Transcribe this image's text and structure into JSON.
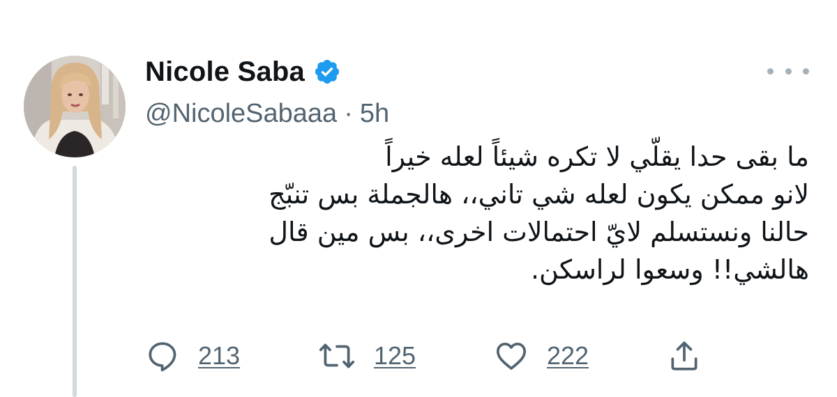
{
  "author": {
    "display_name": "Nicole Saba",
    "handle": "@NicoleSabaaa",
    "separator": "·",
    "time": "5h",
    "verified_icon": "verified-badge-icon",
    "avatar": "avatar"
  },
  "tweet": {
    "lines": [
      "ما بقى حدا يقلّي لا تكره شيئاً لعله خيراً",
      "لانو ممكن يكون لعله شي تاني،، هالجملة بس تنبّج",
      "حالنا ونستسلم لايّ احتمالات اخرى،، بس مين قال",
      "هالشي!! وسعوا لراسكن."
    ]
  },
  "actions": {
    "reply": {
      "icon": "reply-icon",
      "count": "213"
    },
    "retweet": {
      "icon": "retweet-icon",
      "count": "125"
    },
    "like": {
      "icon": "heart-icon",
      "count": "222"
    },
    "share": {
      "icon": "share-icon"
    }
  },
  "more_icon": "more-options-icon",
  "colors": {
    "verified": "#1d9bf0",
    "text": "#0f1419",
    "secondary": "#536471",
    "thread_line": "#cfd9de"
  }
}
